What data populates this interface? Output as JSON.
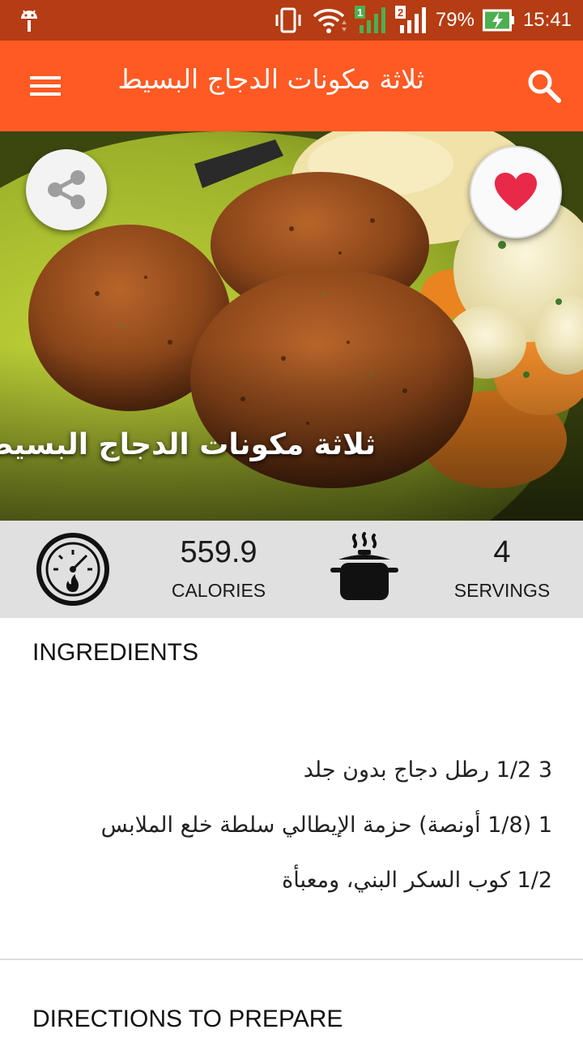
{
  "status_bar": {
    "battery": "79%",
    "time": "15:41",
    "sim1": "1",
    "sim2": "2"
  },
  "app_bar": {
    "title": "ثلاثة مكونات الدجاج البسيط",
    "menu_icon": "hamburger-menu-icon",
    "search_icon": "search-icon"
  },
  "hero": {
    "title": "ثلاثة مكونات الدجاج البسيط",
    "share_icon": "share-icon",
    "favorite_icon": "heart-icon"
  },
  "stats": {
    "calories_value": "559.9",
    "calories_label": "CALORIES",
    "servings_value": "4",
    "servings_label": "SERVINGS"
  },
  "ingredients": {
    "title": "INGREDIENTS",
    "items": [
      "3 1/2 رطل دجاج بدون جلد",
      "1 (1/8 أونصة) حزمة الإيطالي سلطة خلع الملابس",
      "1/2 كوب السكر البني، ومعبأة"
    ]
  },
  "directions": {
    "title": "DIRECTIONS TO PREPARE"
  },
  "colors": {
    "status_bar": "#b53c13",
    "app_bar": "#ff5a24",
    "stats_bg": "#e0e0e0",
    "heart": "#e8294a"
  }
}
